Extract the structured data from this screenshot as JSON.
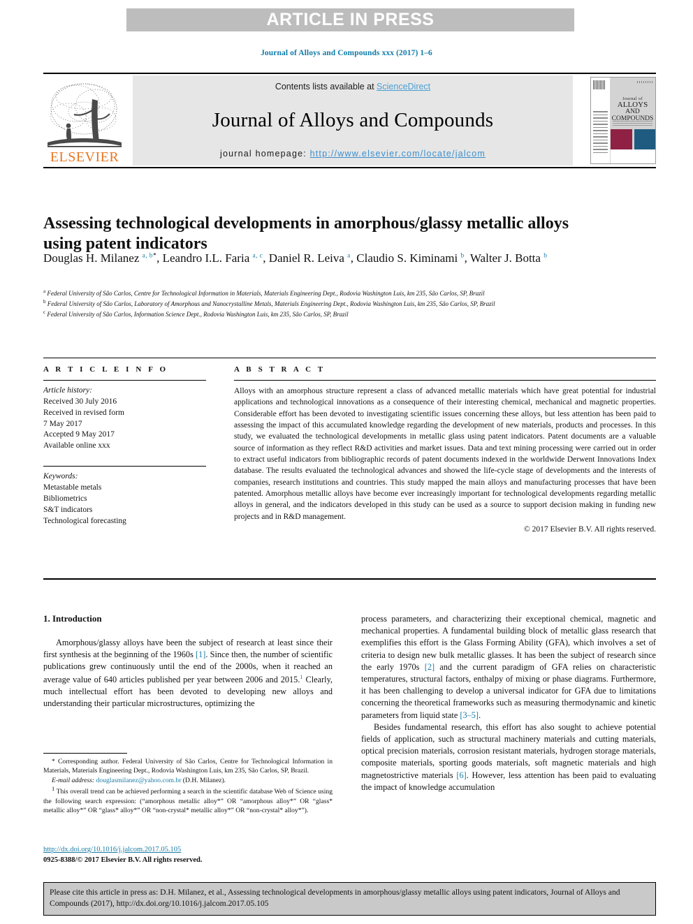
{
  "banner": {
    "text": "ARTICLE IN PRESS"
  },
  "running_citation": "Journal of Alloys and Compounds xxx (2017) 1–6",
  "masthead": {
    "contents_prefix": "Contents lists available at ",
    "sciencedirect": "ScienceDirect",
    "journal_title": "Journal of Alloys and Compounds",
    "homepage_prefix": "journal homepage: ",
    "homepage_url": "http://www.elsevier.com/locate/jalcom",
    "publisher_wordmark": "ELSEVIER",
    "cover": {
      "line1": "Journal of",
      "line2": "ALLOYS",
      "line3": "AND COMPOUNDS"
    }
  },
  "article": {
    "title": "Assessing technological developments in amorphous/glassy metallic alloys using patent indicators",
    "authors_html": "Douglas H. Milanez <sup>a, b</sup><sup class=\"star\">*</sup>, Leandro I.L. Faria <sup>a, c</sup>, Daniel R. Leiva <sup>a</sup>, Claudio S. Kiminami <sup>b</sup>, Walter J. Botta <sup>b</sup>",
    "affiliations": [
      "Federal University of São Carlos, Centre for Technological Information in Materials, Materials Engineering Dept., Rodovia Washington Luis, km 235, São Carlos, SP, Brazil",
      "Federal University of São Carlos, Laboratory of Amorphous and Nanocrystalline Metals, Materials Engineering Dept., Rodovia Washington Luis, km 235, São Carlos, SP, Brazil",
      "Federal University of São Carlos, Information Science Dept., Rodovia Washington Luis, km 235, São Carlos, SP, Brazil"
    ],
    "affiliation_marks": [
      "a",
      "b",
      "c"
    ]
  },
  "article_info": {
    "heading": "A R T I C L E  I N F O",
    "history_label": "Article history:",
    "history": [
      "Received 30 July 2016",
      "Received in revised form",
      "7 May 2017",
      "Accepted 9 May 2017",
      "Available online xxx"
    ],
    "keywords_label": "Keywords:",
    "keywords": [
      "Metastable metals",
      "Bibliometrics",
      "S&T indicators",
      "Technological forecasting"
    ]
  },
  "abstract": {
    "heading": "A B S T R A C T",
    "text": "Alloys with an amorphous structure represent a class of advanced metallic materials which have great potential for industrial applications and technological innovations as a consequence of their interesting chemical, mechanical and magnetic properties. Considerable effort has been devoted to investigating scientific issues concerning these alloys, but less attention has been paid to assessing the impact of this accumulated knowledge regarding the development of new materials, products and processes. In this study, we evaluated the technological developments in metallic glass using patent indicators. Patent documents are a valuable source of information as they reflect R&D activities and market issues. Data and text mining processing were carried out in order to extract useful indicators from bibliographic records of patent documents indexed in the worldwide Derwent Innovations Index database. The results evaluated the technological advances and showed the life-cycle stage of developments and the interests of companies, research institutions and countries. This study mapped the main alloys and manufacturing processes that have been patented. Amorphous metallic alloys have become ever increasingly important for technological developments regarding metallic alloys in general, and the indicators developed in this study can be used as a source to support decision making in funding new projects and in R&D management.",
    "copyright": "© 2017 Elsevier B.V. All rights reserved."
  },
  "body": {
    "section_heading": "1. Introduction",
    "left_paragraph_html": "Amorphous/glassy alloys have been the subject of research at least since their first synthesis at the beginning of the 1960s <span class=\"ref\">[1]</span>. Since then, the number of scientific publications grew continuously until the end of the 2000s, when it reached an average value of 640 articles published per year between 2006 and 2015.<sup class=\"fn\">1</sup> Clearly, much intellectual effort has been devoted to developing new alloys and understanding their particular microstructures, optimizing the",
    "right_paragraph1_html": "process parameters, and characterizing their exceptional chemical, magnetic and mechanical properties. A fundamental building block of metallic glass research that exemplifies this effort is the Glass Forming Ability (GFA), which involves a set of criteria to design new bulk metallic glasses. It has been the subject of research since the early 1970s <span class=\"ref\">[2]</span> and the current paradigm of GFA relies on characteristic temperatures, structural factors, enthalpy of mixing or phase diagrams. Furthermore, it has been challenging to develop a universal indicator for GFA due to limitations concerning the theoretical frameworks such as measuring thermodynamic and kinetic parameters from liquid state <span class=\"ref\">[3–5]</span>.",
    "right_paragraph2_html": "Besides fundamental research, this effort has also sought to achieve potential fields of application, such as structural machinery materials and cutting materials, optical precision materials, corrosion resistant materials, hydrogen storage materials, composite materials, sporting goods materials, soft magnetic materials and high magnetostrictive materials <span class=\"ref\">[6]</span>. However, less attention has been paid to evaluating the impact of knowledge accumulation"
  },
  "footnotes": {
    "corresponding_html": "* Corresponding author. Federal University of São Carlos, Centre for Technological Information in Materials, Materials Engineering Dept., Rodovia Washington Luis, km 235, São Carlos, SP, Brazil.",
    "email_html": "<span class=\"fn-email\">E-mail address:</span> <span class=\"fn-link\">douglasmilanez@yahoo.com.br</span> (D.H. Milanez).",
    "note1_html": "<sup class=\"fn\" style=\"color:#111\">1</sup> This overall trend can be achieved performing a search in the scientific database Web of Science using the following search expression: (“amorphous metallic alloy*” OR “amorphous alloy*” OR “glass* metallic alloy*” OR “glass* alloy*” OR “non-crystal* metallic alloy*” OR “non-crystal* alloy*”)."
  },
  "doi_block": {
    "doi_url": "http://dx.doi.org/10.1016/j.jalcom.2017.05.105",
    "issn_line": "0925-8388/© 2017 Elsevier B.V. All rights reserved."
  },
  "citation_footer": {
    "text": "Please cite this article in press as: D.H. Milanez, et al., Assessing technological developments in amorphous/glassy metallic alloys using patent indicators, Journal of Alloys and Compounds (2017), http://dx.doi.org/10.1016/j.jalcom.2017.05.105"
  },
  "colors": {
    "banner_gray": "#bdbdbd",
    "link_blue": "#1b7ca5",
    "sciencedirect_blue": "#4a9fd4",
    "elsevier_orange": "#e87722",
    "masthead_gray": "#e6e6e6",
    "citation_box_gray": "#c9c9c9",
    "cover_maroon": "#8e2144",
    "cover_blue": "#1f5b80"
  }
}
